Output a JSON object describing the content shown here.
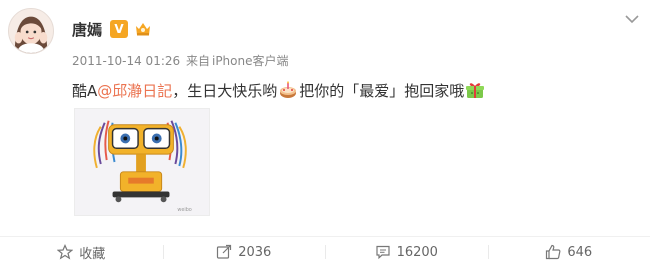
{
  "post": {
    "author": "唐嫣",
    "vip_label": "V",
    "timestamp": "2011-10-14 01:26",
    "source_prefix": "来自",
    "source": "iPhone客户端",
    "text_before": "酷A",
    "mention": "@邱瀞日記",
    "text_middle": "，生日大快乐哟",
    "text_after": "把你的「最爱」抱回家哦"
  },
  "actions": {
    "favorite": "收藏",
    "repost_count": "2036",
    "comment_count": "16200",
    "like_count": "646"
  },
  "colors": {
    "mention": "#eb7350",
    "vip": "#f5a623",
    "meta": "#888888"
  }
}
